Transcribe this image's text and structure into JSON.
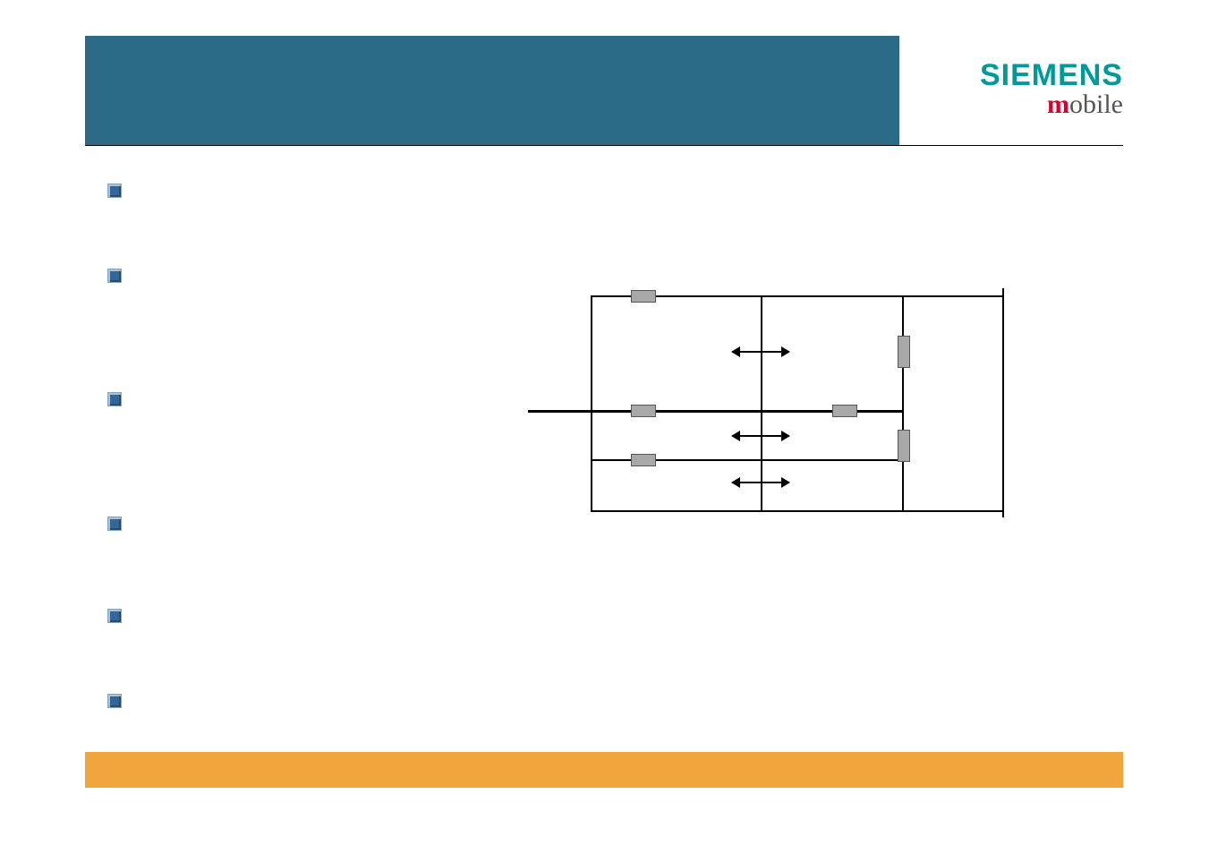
{
  "logo": {
    "brand": "SIEMENS",
    "sub_m": "m",
    "sub_rest": "obile"
  },
  "bullets": [
    {
      "label": ""
    },
    {
      "label": ""
    },
    {
      "label": ""
    },
    {
      "label": ""
    },
    {
      "label": ""
    },
    {
      "label": ""
    }
  ],
  "diagram": {
    "nodes": [],
    "arrows": []
  }
}
